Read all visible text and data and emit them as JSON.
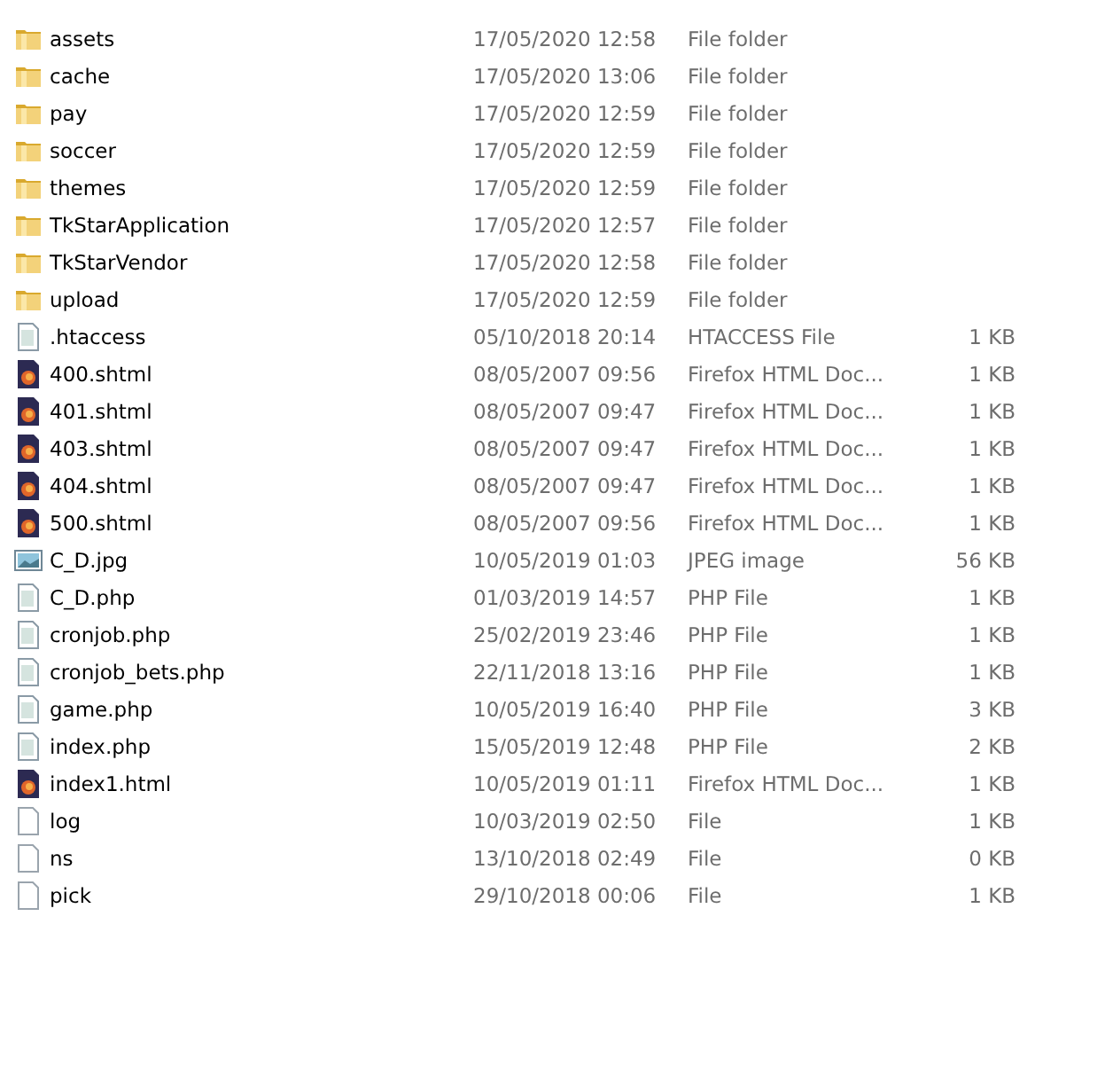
{
  "files": [
    {
      "kind": "folder",
      "name": "assets",
      "date": "17/05/2020 12:58",
      "type": "File folder"
    },
    {
      "kind": "folder",
      "name": "cache",
      "date": "17/05/2020 13:06",
      "type": "File folder"
    },
    {
      "kind": "folder",
      "name": "pay",
      "date": "17/05/2020 12:59",
      "type": "File folder"
    },
    {
      "kind": "folder",
      "name": "soccer",
      "date": "17/05/2020 12:59",
      "type": "File folder"
    },
    {
      "kind": "folder",
      "name": "themes",
      "date": "17/05/2020 12:59",
      "type": "File folder"
    },
    {
      "kind": "folder",
      "name": "TkStarApplication",
      "date": "17/05/2020 12:57",
      "type": "File folder"
    },
    {
      "kind": "folder",
      "name": "TkStarVendor",
      "date": "17/05/2020 12:58",
      "type": "File folder"
    },
    {
      "kind": "folder",
      "name": "upload",
      "date": "17/05/2020 12:59",
      "type": "File folder"
    },
    {
      "kind": "text",
      "name": ".htaccess",
      "date": "05/10/2018 20:14",
      "type": "HTACCESS File",
      "size": "1 KB"
    },
    {
      "kind": "browser",
      "name": "400.shtml",
      "date": "08/05/2007 09:56",
      "type": "Firefox HTML Doc...",
      "size": "1 KB"
    },
    {
      "kind": "browser",
      "name": "401.shtml",
      "date": "08/05/2007 09:47",
      "type": "Firefox HTML Doc...",
      "size": "1 KB"
    },
    {
      "kind": "browser",
      "name": "403.shtml",
      "date": "08/05/2007 09:47",
      "type": "Firefox HTML Doc...",
      "size": "1 KB"
    },
    {
      "kind": "browser",
      "name": "404.shtml",
      "date": "08/05/2007 09:47",
      "type": "Firefox HTML Doc...",
      "size": "1 KB"
    },
    {
      "kind": "browser",
      "name": "500.shtml",
      "date": "08/05/2007 09:56",
      "type": "Firefox HTML Doc...",
      "size": "1 KB"
    },
    {
      "kind": "image",
      "name": "C_D.jpg",
      "date": "10/05/2019 01:03",
      "type": "JPEG image",
      "size": "56 KB"
    },
    {
      "kind": "text",
      "name": "C_D.php",
      "date": "01/03/2019 14:57",
      "type": "PHP File",
      "size": "1 KB"
    },
    {
      "kind": "text",
      "name": "cronjob.php",
      "date": "25/02/2019 23:46",
      "type": "PHP File",
      "size": "1 KB"
    },
    {
      "kind": "text",
      "name": "cronjob_bets.php",
      "date": "22/11/2018 13:16",
      "type": "PHP File",
      "size": "1 KB"
    },
    {
      "kind": "text",
      "name": "game.php",
      "date": "10/05/2019 16:40",
      "type": "PHP File",
      "size": "3 KB"
    },
    {
      "kind": "text",
      "name": "index.php",
      "date": "15/05/2019 12:48",
      "type": "PHP File",
      "size": "2 KB"
    },
    {
      "kind": "browser",
      "name": "index1.html",
      "date": "10/05/2019 01:11",
      "type": "Firefox HTML Doc...",
      "size": "1 KB"
    },
    {
      "kind": "blank",
      "name": "log",
      "date": "10/03/2019 02:50",
      "type": "File",
      "size": "1 KB"
    },
    {
      "kind": "blank",
      "name": "ns",
      "date": "13/10/2018 02:49",
      "type": "File",
      "size": "0 KB"
    },
    {
      "kind": "blank",
      "name": "pick",
      "date": "29/10/2018 00:06",
      "type": "File",
      "size": "1 KB"
    }
  ]
}
